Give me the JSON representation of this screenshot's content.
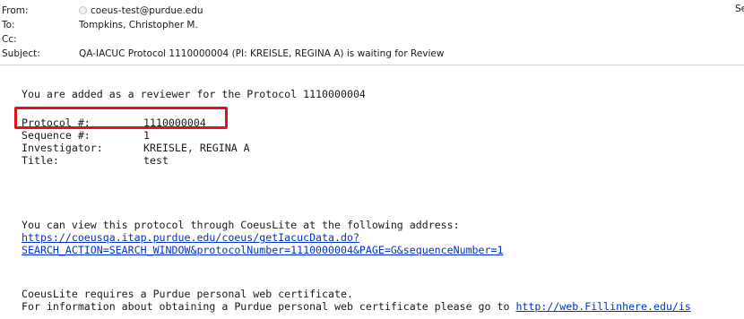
{
  "header": {
    "from_label": "From:",
    "from_value": "coeus-test@purdue.edu",
    "to_label": "To:",
    "to_value": "Tompkins, Christopher M.",
    "cc_label": "Cc:",
    "cc_value": "",
    "subject_label": "Subject:",
    "subject_value": "QA-IACUC Protocol 1110000004 (PI: KREISLE, REGINA A) is waiting for Review",
    "sent_clip": "Se"
  },
  "body": {
    "intro": "You are added as a reviewer for the Protocol 1110000004",
    "fields": [
      {
        "label": "Protocol #:",
        "value": "1110000004"
      },
      {
        "label": "Sequence #:",
        "value": "1"
      },
      {
        "label": "Investigator:",
        "value": "KREISLE, REGINA A"
      },
      {
        "label": "Title:",
        "value": "test"
      }
    ],
    "view_text": "You can view this protocol through CoeusLite at the following address:",
    "link_line1": "https://coeusqa.itap.purdue.edu/coeus/getIacucData.do?",
    "link_line2": "SEARCH_ACTION=SEARCH_WINDOW&protocolNumber=1110000004&PAGE=G&sequenceNumber=1",
    "cert_text": "CoeusLite requires a Purdue personal web certificate.",
    "cert_info": "For information about obtaining a Purdue personal web certificate please go to ",
    "cert_link": "http://web.Fillinhere.edu/is"
  },
  "icons": {
    "presence": "presence-status-icon"
  },
  "colors": {
    "highlight": "#e0121b",
    "link": "#0033cc"
  }
}
